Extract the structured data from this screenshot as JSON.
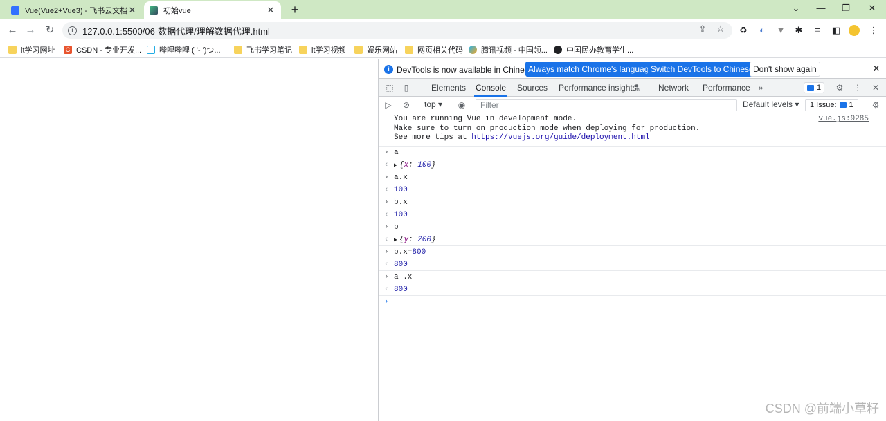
{
  "tabs": [
    {
      "title": "Vue(Vue2+Vue3) - 飞书云文档",
      "favicon_color": "#3370ff"
    },
    {
      "title": "初始vue",
      "favicon_color": "#41b883"
    }
  ],
  "window": {
    "new_tab": "+",
    "minimize": "⌄",
    "restore": "—",
    "maximize": "❐",
    "close": "✕"
  },
  "address": {
    "url": "127.0.0.1:5500/06-数据代理/理解数据代理.html"
  },
  "bookmarks": [
    {
      "label": "it学习网址",
      "icon": "folder-icon"
    },
    {
      "label": "CSDN - 专业开发...",
      "icon": "csdn-icon"
    },
    {
      "label": "哔哩哔哩 ( '- ')つ...",
      "icon": "bilibili-icon"
    },
    {
      "label": "飞书学习笔记",
      "icon": "folder-icon"
    },
    {
      "label": "it学习视频",
      "icon": "folder-icon"
    },
    {
      "label": "娱乐网站",
      "icon": "folder-icon"
    },
    {
      "label": "网页相关代码",
      "icon": "folder-icon"
    },
    {
      "label": "腾讯视频 - 中国领...",
      "icon": "tencent-video-icon"
    },
    {
      "label": "中国民办教育学生...",
      "icon": "globe-icon"
    }
  ],
  "devtools": {
    "infobar": {
      "message": "DevTools is now available in Chinese!",
      "btn_match": "Always match Chrome's language",
      "btn_switch": "Switch DevTools to Chinese",
      "btn_dont": "Don't show again",
      "close": "✕"
    },
    "tabs": [
      "Elements",
      "Console",
      "Sources",
      "Performance insights",
      "Network",
      "Performance"
    ],
    "more": "»",
    "messages_count": "1",
    "filter": {
      "context": "top",
      "placeholder": "Filter",
      "levels": "Default levels",
      "issues": "1 Issue:",
      "issues_count": "1"
    }
  },
  "console": {
    "vue_log": {
      "line1": "You are running Vue in development mode.",
      "line2": "Make sure to turn on production mode when deploying for production.",
      "line3_prefix": "See more tips at ",
      "link": "https://vuejs.org/guide/deployment.html",
      "source": "vue.js:9285"
    },
    "entries": [
      {
        "input": "a",
        "output_key": "x",
        "output_val": "100",
        "type": "obj"
      },
      {
        "input": "a.x",
        "output": "100",
        "type": "num"
      },
      {
        "input": "b.x",
        "output": "100",
        "type": "num"
      },
      {
        "input": "b",
        "output_key": "y",
        "output_val": "200",
        "type": "obj"
      },
      {
        "input_prefix": "b.x=",
        "input_num": "800",
        "output": "800",
        "type": "num"
      },
      {
        "input": "a .x",
        "output": "800",
        "type": "num"
      }
    ]
  },
  "watermark": "CSDN @前端小草籽"
}
